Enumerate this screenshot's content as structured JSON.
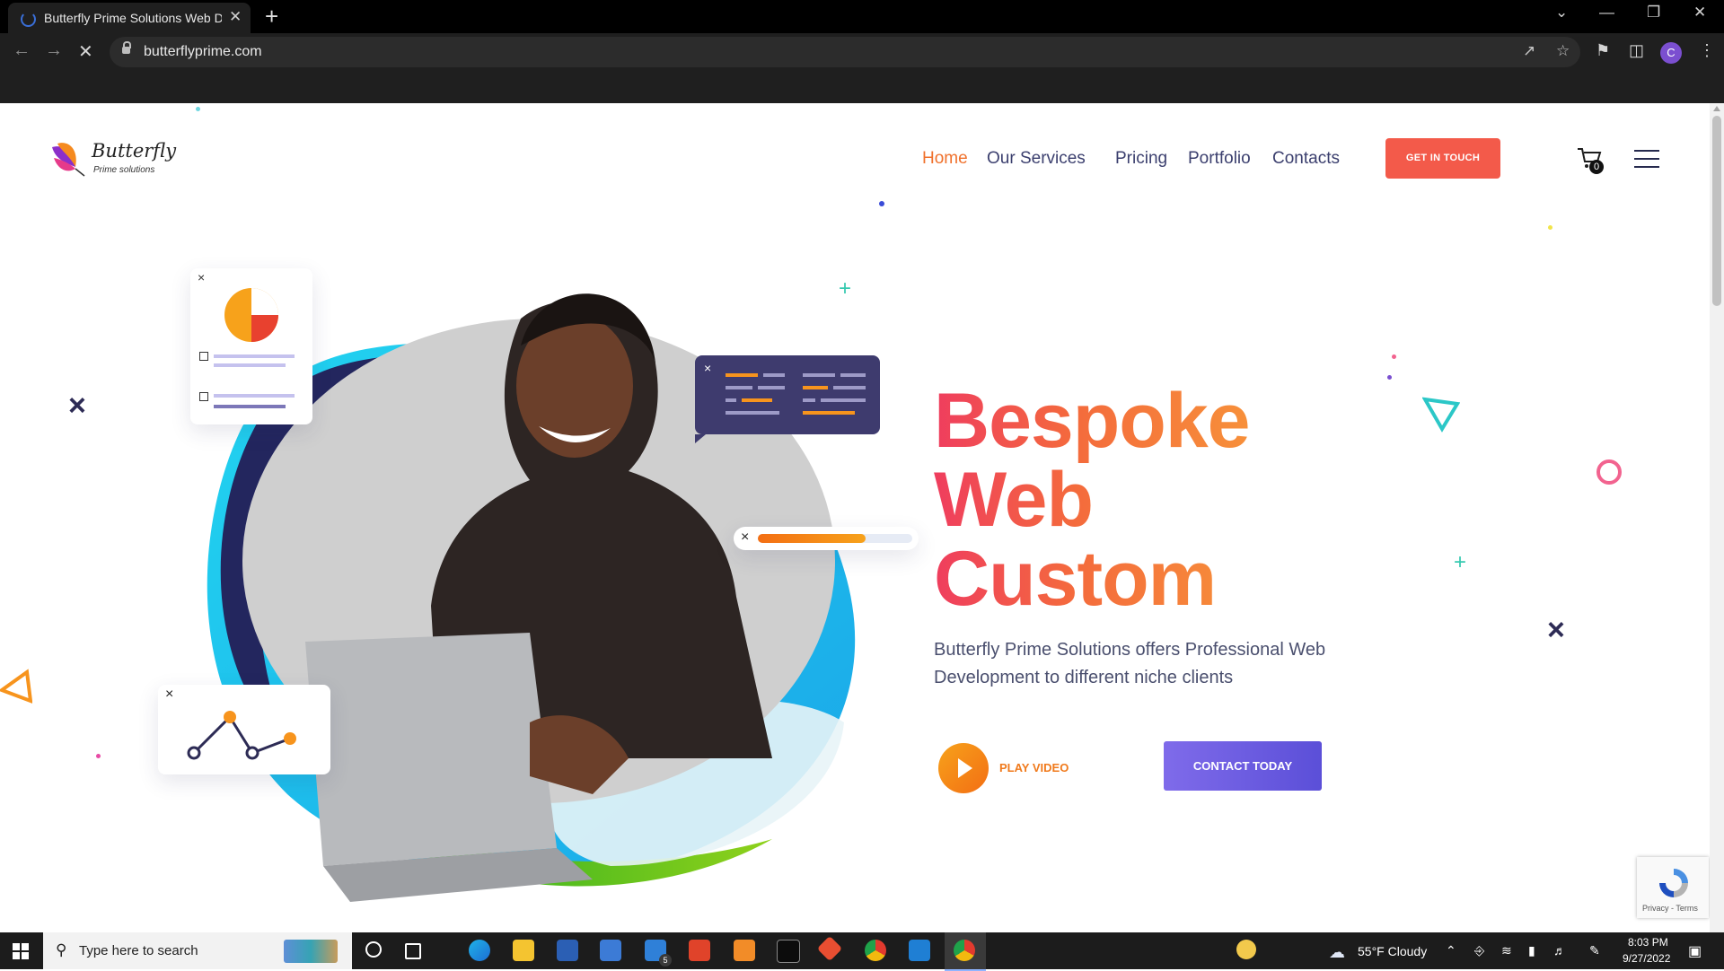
{
  "browser": {
    "tab_title": "Butterfly Prime Solutions Web De",
    "tab_close": "✕",
    "new_tab": "+",
    "url": "butterflyprime.com",
    "window_controls": [
      "⌄",
      "—",
      "❐",
      "✕"
    ]
  },
  "site": {
    "logo_name": "Butterfly",
    "logo_tagline": "Prime solutions",
    "nav": [
      "Home",
      "Our Services",
      "Pricing",
      "Portfolio",
      "Contacts"
    ],
    "cta": "GET IN TOUCH",
    "cart_count": "0",
    "headline": [
      "Bespoke",
      "Web",
      "Custom"
    ],
    "subtitle": "Butterfly Prime Solutions offers Professional Web Development to different niche clients",
    "play_label": "PLAY VIDEO",
    "contact_label": "CONTACT TODAY",
    "recaptcha_text": "Privacy - Terms"
  },
  "taskbar": {
    "search_placeholder": "Type here to search",
    "weather": "55°F  Cloudy",
    "time": "8:03 PM",
    "date": "9/27/2022",
    "mail_badge": "5"
  },
  "colors": {
    "accent_orange": "#f0712c",
    "nav_text": "#3b3f6e",
    "cta_red": "#f35a4a",
    "contact_purple": "#6a5be0"
  }
}
